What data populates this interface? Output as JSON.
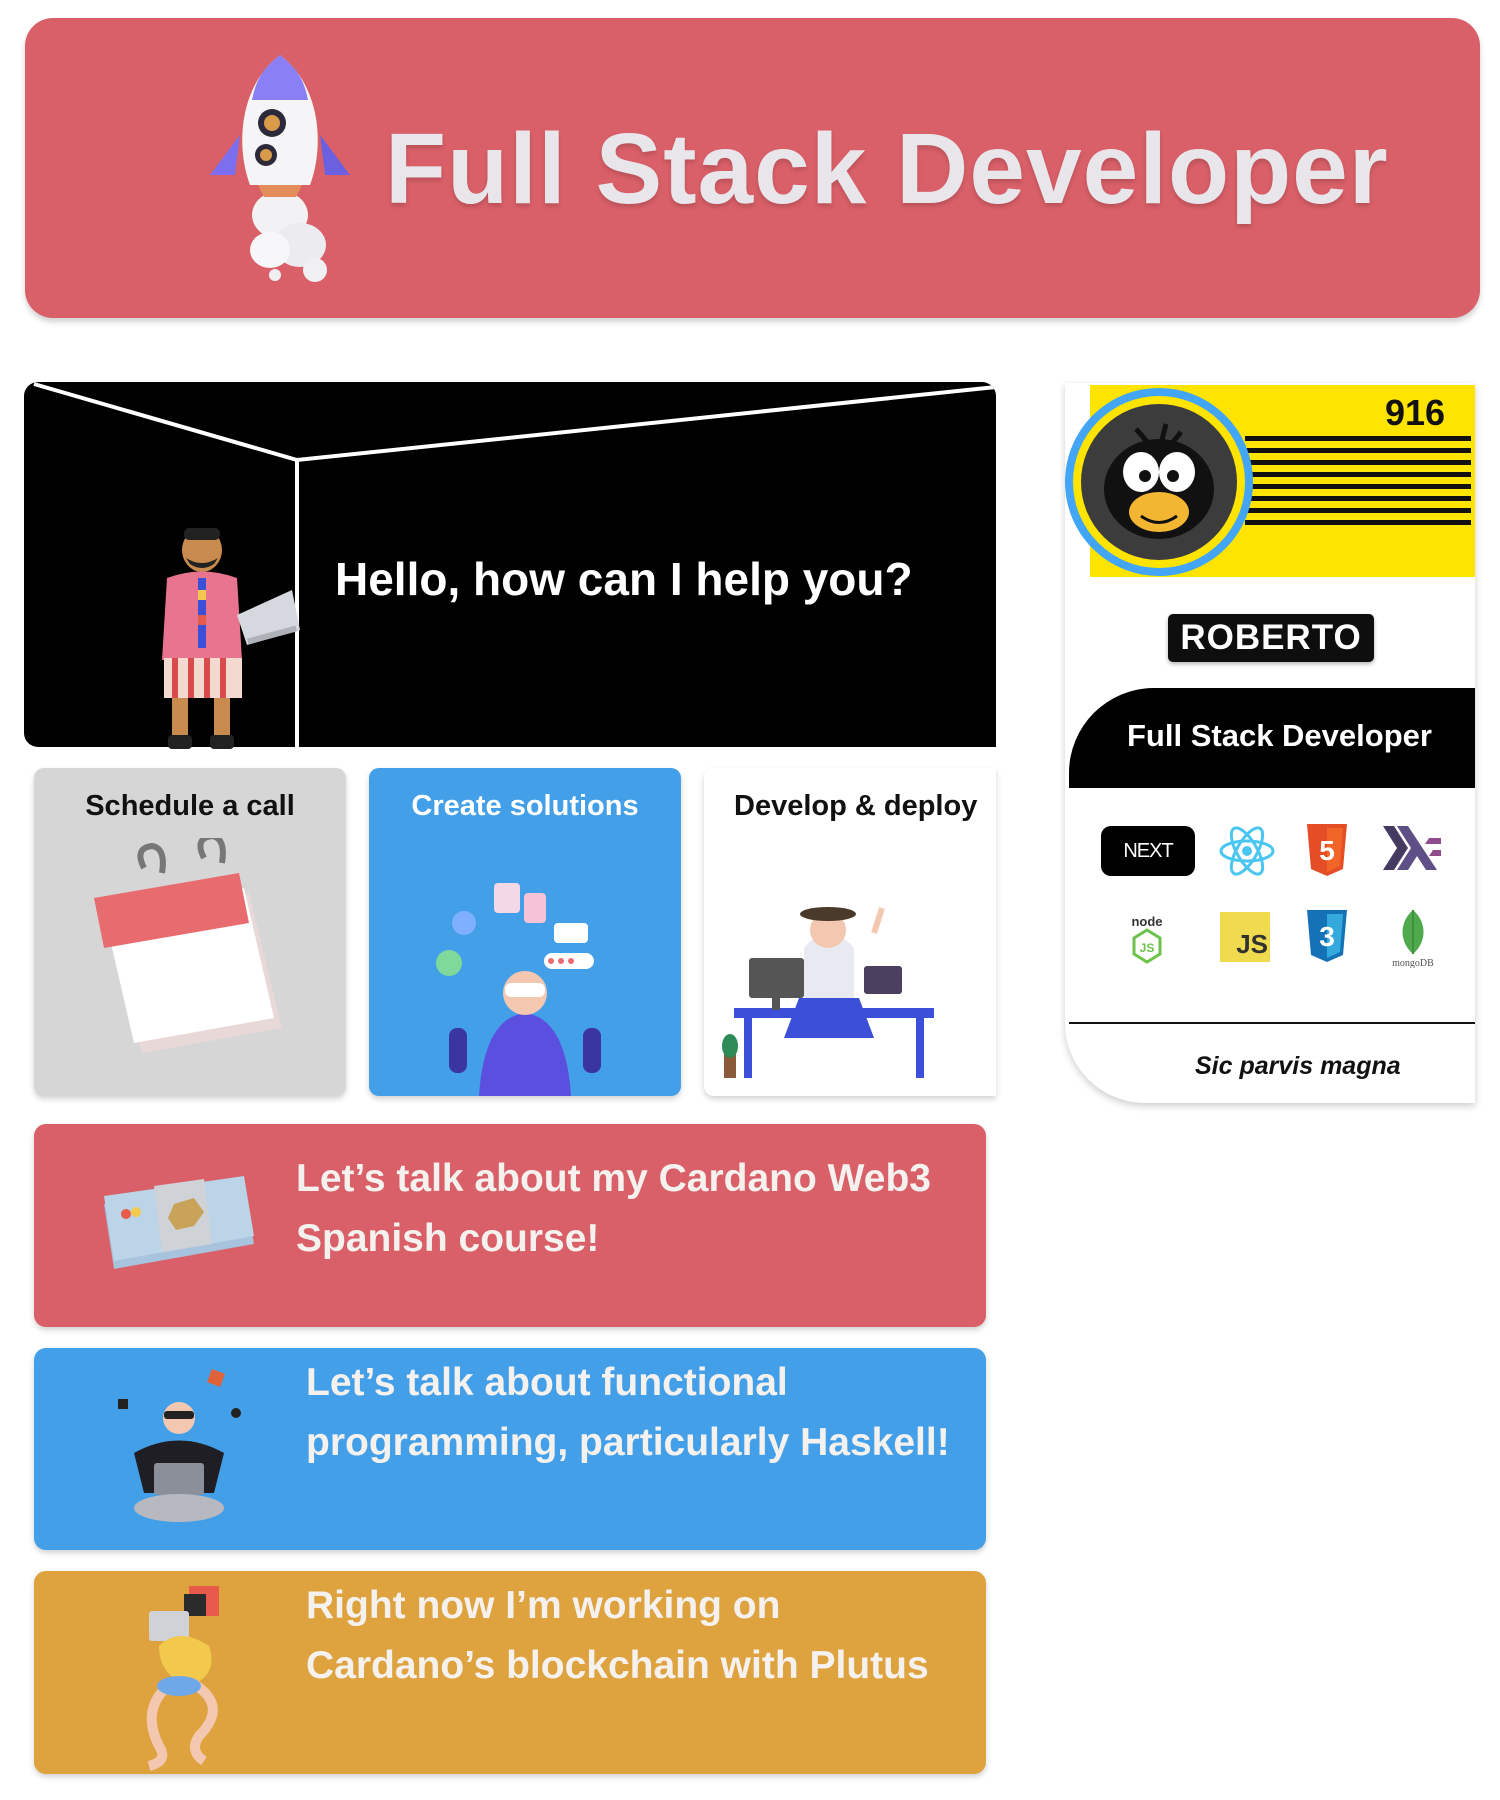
{
  "header": {
    "title": "Full Stack Developer",
    "icon": "rocket-icon"
  },
  "hero": {
    "greeting": "Hello, how can I help you?"
  },
  "cards": [
    {
      "title": "Schedule a call",
      "icon": "calendar-icon",
      "color": "#d6d6d6"
    },
    {
      "title": "Create solutions",
      "icon": "solutions-illustration",
      "color": "#43a0e8"
    },
    {
      "title": "Develop & deploy",
      "icon": "developer-desk-illustration",
      "color": "#ffffff"
    }
  ],
  "promos": [
    {
      "text": "Let’s talk about my Cardano Web3 Spanish course!",
      "color": "#d95f68"
    },
    {
      "text": "Let’s talk about functional programming, particularly Haskell!",
      "color": "#43a0e8"
    },
    {
      "text": "Right now I’m working on Cardano’s blockchain with Plutus",
      "color": "#dea33e"
    }
  ],
  "profile": {
    "score": "916",
    "name": "ROBERTO",
    "role": "Full Stack Developer",
    "motto": "Sic parvis magna",
    "tech": {
      "next_label": "NEXT",
      "node_label": "node",
      "js_label": "JS",
      "mongo_label": "mongoDB",
      "html_label": "5",
      "css_label": "3"
    }
  }
}
